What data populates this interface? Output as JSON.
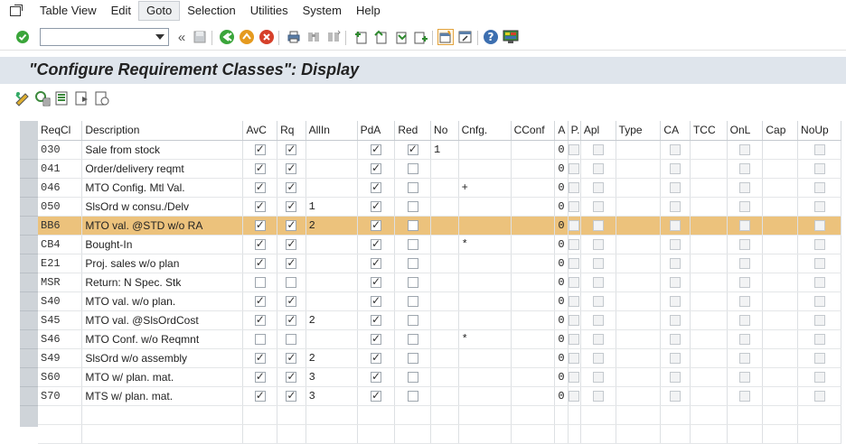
{
  "menu": {
    "items": [
      {
        "label": "Table View"
      },
      {
        "label": "Edit"
      },
      {
        "label": "Goto"
      },
      {
        "label": "Selection"
      },
      {
        "label": "Utilities"
      },
      {
        "label": "System"
      },
      {
        "label": "Help"
      }
    ]
  },
  "toolbar": {
    "command_value": "",
    "overflow_glyph": "«"
  },
  "title": "\"Configure Requirement Classes\": Display",
  "table": {
    "columns": [
      "ReqCl",
      "Description",
      "AvC",
      "Rq",
      "AllIn",
      "PdA",
      "Red",
      "No",
      "Cnfg.",
      "CConf",
      "A",
      "P.",
      "Apl",
      "Type",
      "CA",
      "TCC",
      "OnL",
      "Cap",
      "NoUp"
    ],
    "rows": [
      {
        "reqcl": "030",
        "desc": "Sale from stock",
        "avc": true,
        "rq": true,
        "allin": "",
        "pda": true,
        "red": true,
        "no": "1",
        "cnfg": "",
        "a": "0",
        "p": false,
        "apl": false,
        "ca": false,
        "onl": false,
        "noup": false
      },
      {
        "reqcl": "041",
        "desc": "Order/delivery reqmt",
        "avc": true,
        "rq": true,
        "allin": "",
        "pda": true,
        "red": false,
        "no": "",
        "cnfg": "",
        "a": "0",
        "p": false,
        "apl": false,
        "ca": false,
        "onl": false,
        "noup": false
      },
      {
        "reqcl": "046",
        "desc": "MTO Config. Mtl Val.",
        "avc": true,
        "rq": true,
        "allin": "",
        "pda": true,
        "red": false,
        "no": "",
        "cnfg": "+",
        "a": "0",
        "p": false,
        "apl": false,
        "ca": false,
        "onl": false,
        "noup": false
      },
      {
        "reqcl": "050",
        "desc": "SlsOrd w consu./Delv",
        "avc": true,
        "rq": true,
        "allin": "1",
        "pda": true,
        "red": false,
        "no": "",
        "cnfg": "",
        "a": "0",
        "p": false,
        "apl": false,
        "ca": false,
        "onl": false,
        "noup": false
      },
      {
        "reqcl": "BB6",
        "desc": "MTO val. @STD w/o RA",
        "avc": true,
        "rq": true,
        "allin": "2",
        "pda": true,
        "red": false,
        "no": "",
        "cnfg": "",
        "a": "0",
        "p": false,
        "apl": false,
        "ca": false,
        "onl": false,
        "noup": false
      },
      {
        "reqcl": "CB4",
        "desc": "Bought-In",
        "avc": true,
        "rq": true,
        "allin": "",
        "pda": true,
        "red": false,
        "no": "",
        "cnfg": "*",
        "a": "0",
        "p": false,
        "apl": false,
        "ca": false,
        "onl": false,
        "noup": false
      },
      {
        "reqcl": "E21",
        "desc": "Proj. sales w/o plan",
        "avc": true,
        "rq": true,
        "allin": "",
        "pda": true,
        "red": false,
        "no": "",
        "cnfg": "",
        "a": "0",
        "p": false,
        "apl": false,
        "ca": false,
        "onl": false,
        "noup": false
      },
      {
        "reqcl": "MSR",
        "desc": "Return: N Spec. Stk",
        "avc": false,
        "rq": false,
        "allin": "",
        "pda": true,
        "red": false,
        "no": "",
        "cnfg": "",
        "a": "0",
        "p": false,
        "apl": false,
        "ca": false,
        "onl": false,
        "noup": false
      },
      {
        "reqcl": "S40",
        "desc": "MTO val. w/o plan.",
        "avc": true,
        "rq": true,
        "allin": "",
        "pda": true,
        "red": false,
        "no": "",
        "cnfg": "",
        "a": "0",
        "p": false,
        "apl": false,
        "ca": false,
        "onl": false,
        "noup": false
      },
      {
        "reqcl": "S45",
        "desc": "MTO val. @SlsOrdCost",
        "avc": true,
        "rq": true,
        "allin": "2",
        "pda": true,
        "red": false,
        "no": "",
        "cnfg": "",
        "a": "0",
        "p": false,
        "apl": false,
        "ca": false,
        "onl": false,
        "noup": false
      },
      {
        "reqcl": "S46",
        "desc": "MTO Conf. w/o Reqmnt",
        "avc": false,
        "rq": false,
        "allin": "",
        "pda": true,
        "red": false,
        "no": "",
        "cnfg": "*",
        "a": "0",
        "p": false,
        "apl": false,
        "ca": false,
        "onl": false,
        "noup": false
      },
      {
        "reqcl": "S49",
        "desc": "SlsOrd w/o assembly",
        "avc": true,
        "rq": true,
        "allin": "2",
        "pda": true,
        "red": false,
        "no": "",
        "cnfg": "",
        "a": "0",
        "p": false,
        "apl": false,
        "ca": false,
        "onl": false,
        "noup": false
      },
      {
        "reqcl": "S60",
        "desc": "MTO w/ plan. mat.",
        "avc": true,
        "rq": true,
        "allin": "3",
        "pda": true,
        "red": false,
        "no": "",
        "cnfg": "",
        "a": "0",
        "p": false,
        "apl": false,
        "ca": false,
        "onl": false,
        "noup": false
      },
      {
        "reqcl": "S70",
        "desc": "MTS w/ plan. mat.",
        "avc": true,
        "rq": true,
        "allin": "3",
        "pda": true,
        "red": false,
        "no": "",
        "cnfg": "",
        "a": "0",
        "p": false,
        "apl": false,
        "ca": false,
        "onl": false,
        "noup": false
      }
    ],
    "selected_row": "BB6",
    "selected_color": "#ecc27c"
  },
  "colors": {
    "title_band": "#dfe5ec",
    "selection_column": "#cfd4d9",
    "accent_green": "#3aa53a",
    "accent_orange": "#e59a1f",
    "accent_red": "#d6402a"
  }
}
